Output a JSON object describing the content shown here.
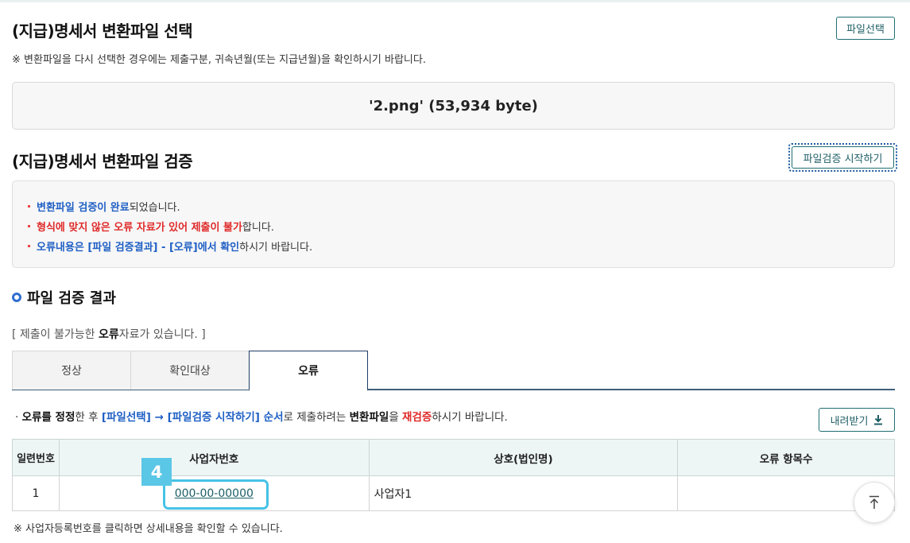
{
  "select_section": {
    "title": "(지급)명세서 변환파일 선택",
    "note": "※ 변환파일을 다시 선택한 경우에는 제출구분, 귀속년월(또는 지급년월)을 확인하시기 바랍니다.",
    "button_label": "파일선택",
    "file_info": "'2.png' (53,934 byte)"
  },
  "verify_section": {
    "title": "(지급)명세서 변환파일 검증",
    "button_label": "파일검증 시작하기",
    "messages": [
      {
        "parts": [
          {
            "text": "변환파일 검증이 완료",
            "style": "blue"
          },
          {
            "text": "되었습니다.",
            "style": "plain"
          }
        ]
      },
      {
        "parts": [
          {
            "text": "형식에 맞지 않은 오류 자료가 있어 제출이 불가",
            "style": "red"
          },
          {
            "text": "합니다.",
            "style": "plain"
          }
        ]
      },
      {
        "parts": [
          {
            "text": "오류내용은 [파일 검증결과] - [오류]에서 확인",
            "style": "blue"
          },
          {
            "text": "하시기 바랍니다.",
            "style": "plain"
          }
        ]
      }
    ]
  },
  "result_section": {
    "title": "파일 검증 결과",
    "summary_prefix": "[ 제출이 불가능한 ",
    "summary_bold": "오류",
    "summary_suffix": "자료가 있습니다. ]",
    "tabs": [
      "정상",
      "확인대상",
      "오류"
    ],
    "active_tab": 2,
    "instruction_parts": [
      {
        "text": "· ",
        "style": "plain"
      },
      {
        "text": "오류를 정정",
        "style": "strong"
      },
      {
        "text": "한 후 ",
        "style": "plain"
      },
      {
        "text": "[파일선택] → [파일검증 시작하기] 순서",
        "style": "blue"
      },
      {
        "text": "로 제출하려는 ",
        "style": "plain"
      },
      {
        "text": "변환파일",
        "style": "strong"
      },
      {
        "text": "을 ",
        "style": "plain"
      },
      {
        "text": "재검증",
        "style": "red"
      },
      {
        "text": "하시기 바랍니다.",
        "style": "plain"
      }
    ],
    "download_label": "내려받기",
    "table": {
      "headers": [
        "일련번호",
        "사업자번호",
        "상호(법인명)",
        "오류 항목수"
      ],
      "rows": [
        {
          "seq": "1",
          "biz_no": "000-00-00000",
          "name": "사업자1",
          "error_count": ""
        }
      ]
    },
    "badge_number": "4",
    "footnote": "※ 사업자등록번호를 클릭하면 상세내용을 확인할 수 있습니다."
  },
  "colors": {
    "accent": "#1f6e73",
    "blue_text": "#1f5fc4",
    "red_text": "#e02a2a",
    "highlight": "#46c2e6"
  }
}
